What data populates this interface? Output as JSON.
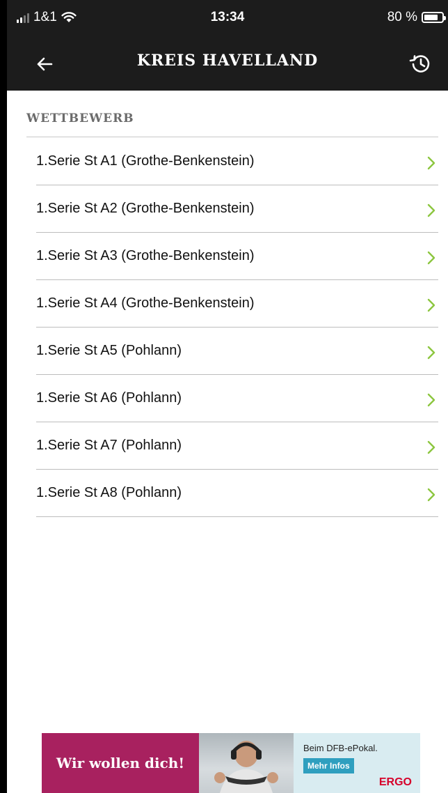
{
  "status_bar": {
    "carrier": "1&1",
    "time": "13:34",
    "battery_text": "80 %",
    "battery_level": 0.8
  },
  "nav": {
    "title": "KREIS HAVELLAND",
    "back_icon": "arrow-left-icon",
    "history_icon": "history-icon"
  },
  "section": {
    "title": "WETTBEWERB"
  },
  "list": {
    "items": [
      {
        "label": "1.Serie St A1 (Grothe-Benkenstein)"
      },
      {
        "label": "1.Serie St A2 (Grothe-Benkenstein)"
      },
      {
        "label": "1.Serie St A3 (Grothe-Benkenstein)"
      },
      {
        "label": "1.Serie St A4 (Grothe-Benkenstein)"
      },
      {
        "label": "1.Serie St A5 (Pohlann)"
      },
      {
        "label": "1.Serie St A6 (Pohlann)"
      },
      {
        "label": "1.Serie St A7 (Pohlann)"
      },
      {
        "label": "1.Serie St A8 (Pohlann)"
      }
    ],
    "chevron_color": "#8cc63f"
  },
  "ad": {
    "slogan": "Wir wollen dich!",
    "headline": "Beim DFB-ePokal.",
    "cta": "Mehr Infos",
    "brand": "ERGO"
  },
  "colors": {
    "bar_bg": "#1c1c1c",
    "accent": "#8cc63f",
    "ad_magenta": "#a8215f"
  }
}
